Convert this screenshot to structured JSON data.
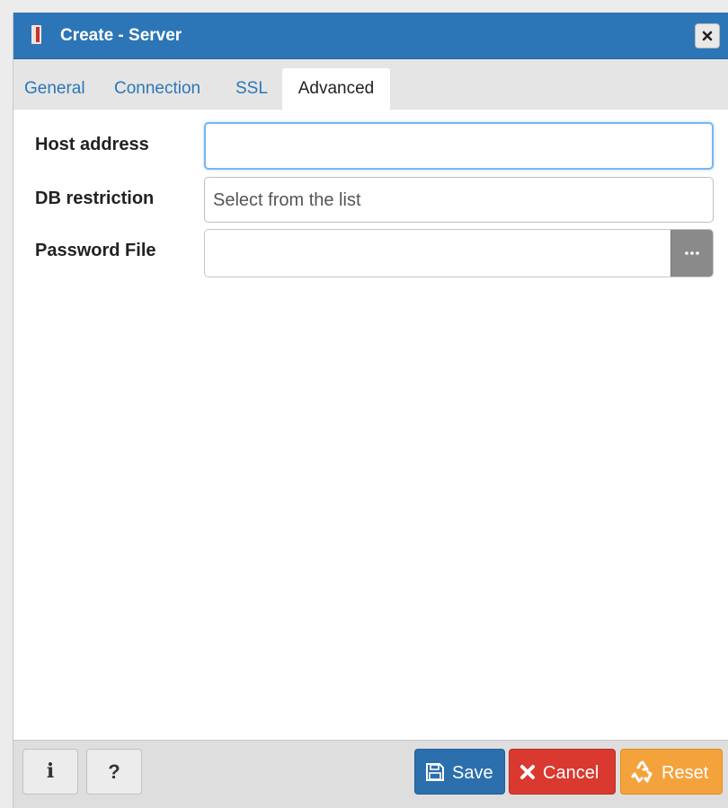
{
  "dialog": {
    "title": "Create - Server",
    "title_icon": "server-icon",
    "close_icon": "close-icon"
  },
  "tabs": [
    {
      "label": "General",
      "active": false
    },
    {
      "label": "Connection",
      "active": false
    },
    {
      "label": "SSL",
      "active": false
    },
    {
      "label": "Advanced",
      "active": true
    }
  ],
  "form": {
    "host_address": {
      "label": "Host address",
      "value": ""
    },
    "db_restriction": {
      "label": "DB restriction",
      "placeholder": "Select from the list",
      "value": ""
    },
    "password_file": {
      "label": "Password File",
      "value": "",
      "browse_icon": "ellipsis-icon"
    }
  },
  "footer": {
    "info_label": "i",
    "help_label": "?",
    "save_label": "Save",
    "cancel_label": "Cancel",
    "reset_label": "Reset",
    "save_icon": "floppy-disk-icon",
    "cancel_icon": "x-icon",
    "reset_icon": "recycle-icon"
  },
  "colors": {
    "titlebar": "#2c76b7",
    "tab_link": "#2c76b7",
    "save": "#2c6fad",
    "cancel": "#d9392f",
    "reset": "#f4a33c",
    "focus_border": "#7ab6ee"
  }
}
